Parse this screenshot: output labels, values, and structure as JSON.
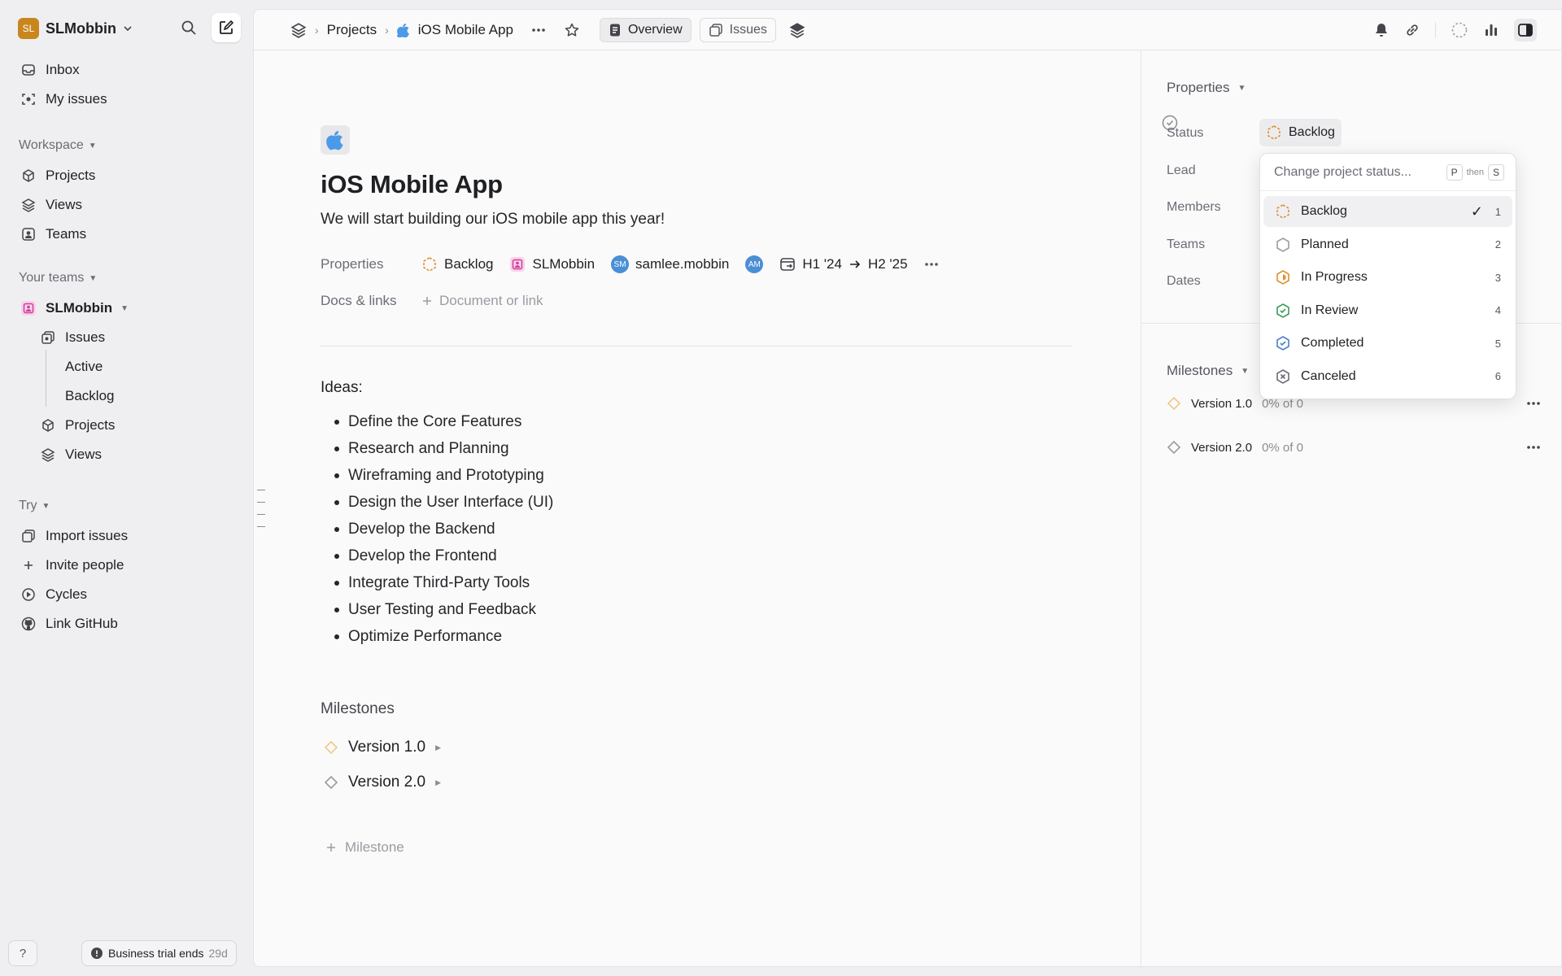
{
  "workspace": {
    "avatar": "SL",
    "name": "SLMobbin",
    "avatar_color": "#c9861e"
  },
  "sidebar": {
    "top_items": [
      {
        "label": "Inbox",
        "icon": "inbox-icon"
      },
      {
        "label": "My issues",
        "icon": "target-icon"
      }
    ],
    "workspace_header": "Workspace",
    "workspace_items": [
      {
        "label": "Projects",
        "icon": "cube-icon"
      },
      {
        "label": "Views",
        "icon": "layers-icon"
      },
      {
        "label": "Teams",
        "icon": "team-icon"
      }
    ],
    "teams_header": "Your teams",
    "team_name": "SLMobbin",
    "team_items": [
      {
        "label": "Issues"
      },
      {
        "label": "Active"
      },
      {
        "label": "Backlog"
      },
      {
        "label": "Projects"
      },
      {
        "label": "Views"
      }
    ],
    "try_header": "Try",
    "try_items": [
      {
        "label": "Import issues"
      },
      {
        "label": "Invite people"
      },
      {
        "label": "Cycles"
      },
      {
        "label": "Link GitHub"
      }
    ],
    "help_label": "?",
    "trial_label": "Business trial ends",
    "trial_days": "29d"
  },
  "topbar": {
    "crumb_projects": "Projects",
    "crumb_project": "iOS Mobile App",
    "tab_overview": "Overview",
    "tab_issues": "Issues"
  },
  "project": {
    "title": "iOS Mobile App",
    "description": "We will start building our iOS mobile app this year!",
    "properties_label": "Properties",
    "status": "Backlog",
    "team": "SLMobbin",
    "lead_avatar": "SM",
    "lead": "samlee.mobbin",
    "member_avatar": "AM",
    "date_start": "H1 '24",
    "date_end": "H2 '25",
    "docs_label": "Docs & links",
    "docs_add": "Document or link",
    "ideas_title": "Ideas:",
    "ideas": [
      "Define the Core Features",
      "Research and Planning",
      "Wireframing and Prototyping",
      "Design the User Interface (UI)",
      "Develop the Backend",
      "Develop the Frontend",
      "Integrate Third-Party Tools",
      "User Testing and Feedback",
      "Optimize Performance"
    ],
    "milestones_title": "Milestones",
    "milestones": [
      "Version 1.0",
      "Version 2.0"
    ],
    "milestone_add": "Milestone"
  },
  "right_pane": {
    "properties_header": "Properties",
    "labels": {
      "status": "Status",
      "lead": "Lead",
      "members": "Members",
      "teams": "Teams",
      "dates": "Dates"
    },
    "status_value": "Backlog",
    "milestones_header": "Milestones",
    "milestones": [
      {
        "name": "Version 1.0",
        "progress": "0% of 0"
      },
      {
        "name": "Version 2.0",
        "progress": "0% of 0"
      }
    ]
  },
  "status_dropdown": {
    "placeholder": "Change project status...",
    "shortcut_key1": "P",
    "shortcut_then": "then",
    "shortcut_key2": "S",
    "options": [
      {
        "label": "Backlog",
        "num": "1",
        "color": "#e0912f"
      },
      {
        "label": "Planned",
        "num": "2",
        "color": "#9a9ca3"
      },
      {
        "label": "In Progress",
        "num": "3",
        "color": "#e0912f"
      },
      {
        "label": "In Review",
        "num": "4",
        "color": "#3d9a5e"
      },
      {
        "label": "Completed",
        "num": "5",
        "color": "#4a7fd0"
      },
      {
        "label": "Canceled",
        "num": "6",
        "color": "#6b6d75"
      }
    ],
    "selected": "Backlog"
  }
}
